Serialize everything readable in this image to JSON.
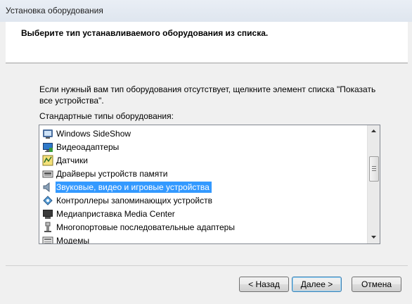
{
  "window": {
    "title": "Установка оборудования"
  },
  "header": {
    "heading": "Выберите тип устанавливаемого оборудования из списка."
  },
  "body": {
    "description": "Если нужный вам тип оборудования отсутствует, щелкните элемент списка \"Показать все устройства\".",
    "list_label": "Стандартные типы оборудования:"
  },
  "list": {
    "items": [
      {
        "label": "Windows SideShow",
        "icon": "sideshow-icon"
      },
      {
        "label": "Видеоадаптеры",
        "icon": "display-adapter-icon"
      },
      {
        "label": "Датчики",
        "icon": "sensor-icon"
      },
      {
        "label": "Драйверы устройств памяти",
        "icon": "memory-device-icon"
      },
      {
        "label": "Звуковые, видео и игровые устройства",
        "icon": "speaker-icon",
        "selected": true
      },
      {
        "label": "Контроллеры запоминающих устройств",
        "icon": "storage-controller-icon"
      },
      {
        "label": "Медиаприставка Media Center",
        "icon": "media-center-icon"
      },
      {
        "label": "Многопортовые последовательные адаптеры",
        "icon": "serial-adapter-icon"
      },
      {
        "label": "Модемы",
        "icon": "modem-icon"
      }
    ]
  },
  "buttons": {
    "back": "< Назад",
    "next": "Далее >",
    "cancel": "Отмена"
  },
  "colors": {
    "selection": "#3399ff",
    "accent_border": "#3c7fb1"
  }
}
